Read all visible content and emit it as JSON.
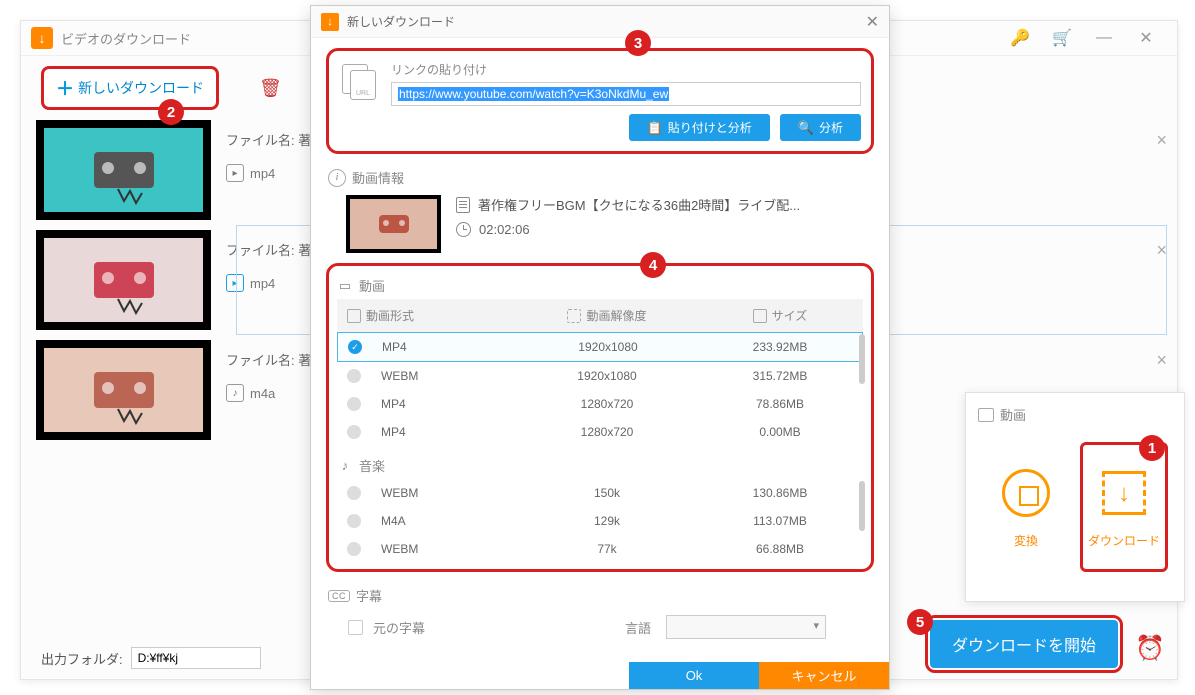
{
  "main": {
    "title": "ビデオのダウンロード",
    "new_download_btn": "新しいダウンロード",
    "items": [
      {
        "filename_label": "ファイル名: 著作",
        "format": "mp4"
      },
      {
        "filename_label": "ファイル名: 著作",
        "format": "mp4"
      },
      {
        "filename_label": "ファイル名: 著作",
        "format": "m4a"
      }
    ],
    "output_folder_label": "出力フォルダ:",
    "output_folder_value": "D:¥ff¥kj"
  },
  "dialog": {
    "title": "新しいダウンロード",
    "link_paste_label": "リンクの貼り付け",
    "url_value": "https://www.youtube.com/watch?v=K3oNkdMu_ew",
    "url_icon_text": "URL",
    "paste_analyze_btn": "貼り付けと分析",
    "analyze_btn": "分析",
    "video_info_header": "動画情報",
    "video_title": "著作権フリーBGM【クセになる36曲2時間】ライブ配...",
    "duration": "02:02:06",
    "video_section": "動画",
    "columns": {
      "format": "動画形式",
      "resolution": "動画解像度",
      "size": "サイズ"
    },
    "video_rows": [
      {
        "format": "MP4",
        "res": "1920x1080",
        "size": "233.92MB",
        "selected": true
      },
      {
        "format": "WEBM",
        "res": "1920x1080",
        "size": "315.72MB",
        "selected": false
      },
      {
        "format": "MP4",
        "res": "1280x720",
        "size": "78.86MB",
        "selected": false
      },
      {
        "format": "MP4",
        "res": "1280x720",
        "size": "0.00MB",
        "selected": false
      }
    ],
    "audio_section": "音楽",
    "audio_rows": [
      {
        "format": "WEBM",
        "res": "150k",
        "size": "130.86MB"
      },
      {
        "format": "M4A",
        "res": "129k",
        "size": "113.07MB"
      },
      {
        "format": "WEBM",
        "res": "77k",
        "size": "66.88MB"
      }
    ],
    "subtitle_header": "字幕",
    "original_subtitle": "元の字幕",
    "language_label": "言語",
    "ok": "Ok",
    "cancel": "キャンセル"
  },
  "side": {
    "header": "動画",
    "convert": "変換",
    "download": "ダウンロード"
  },
  "start_download": "ダウンロードを開始",
  "badges": {
    "b1": "1",
    "b2": "2",
    "b3": "3",
    "b4": "4",
    "b5": "5"
  }
}
